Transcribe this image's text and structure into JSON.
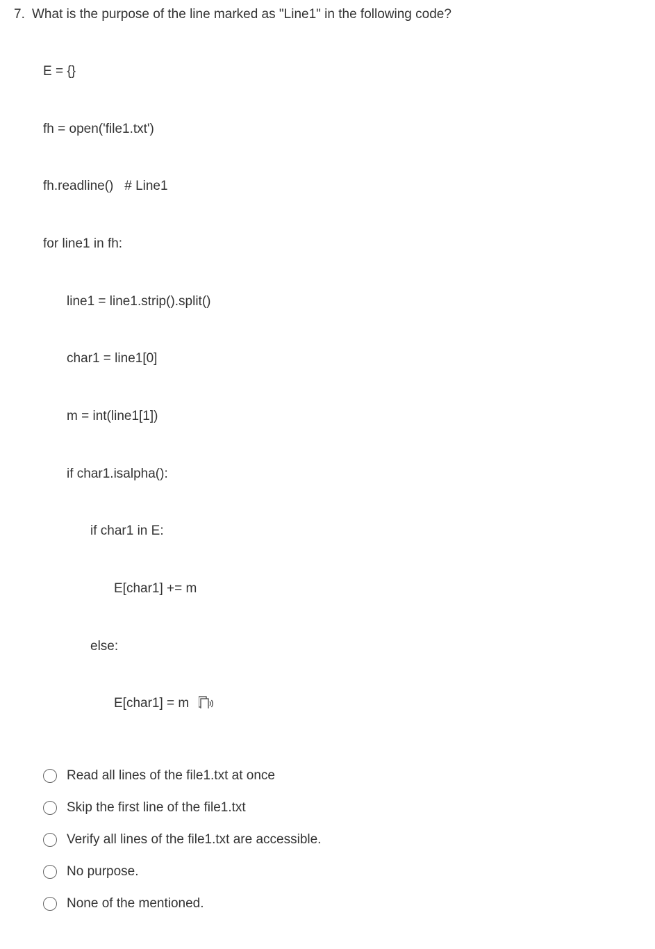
{
  "question": {
    "number": "7.",
    "text": "What is the purpose of the line marked as \"Line1\" in the following code?"
  },
  "code": [
    {
      "indent": 0,
      "text": "E = {}"
    },
    {
      "indent": 0,
      "text": "fh = open('file1.txt')"
    },
    {
      "indent": 0,
      "text": "fh.readline()   # Line1"
    },
    {
      "indent": 0,
      "text": "for line1 in fh:"
    },
    {
      "indent": 1,
      "text": "line1 = line1.strip().split()"
    },
    {
      "indent": 1,
      "text": "char1 = line1[0]"
    },
    {
      "indent": 1,
      "text": "m = int(line1[1])"
    },
    {
      "indent": 1,
      "text": "if char1.isalpha():"
    },
    {
      "indent": 2,
      "text": "if char1 in E:"
    },
    {
      "indent": 3,
      "text": "E[char1] += m"
    },
    {
      "indent": 2,
      "text": "else:"
    },
    {
      "indent": 3,
      "text": "E[char1] = m",
      "icon": true
    }
  ],
  "options": [
    {
      "label": "Read all lines of the file1.txt at once"
    },
    {
      "label": "Skip the first line of the file1.txt"
    },
    {
      "label": "Verify all lines of the file1.txt are accessible."
    },
    {
      "label": "No purpose."
    },
    {
      "label": "None of the mentioned."
    }
  ]
}
